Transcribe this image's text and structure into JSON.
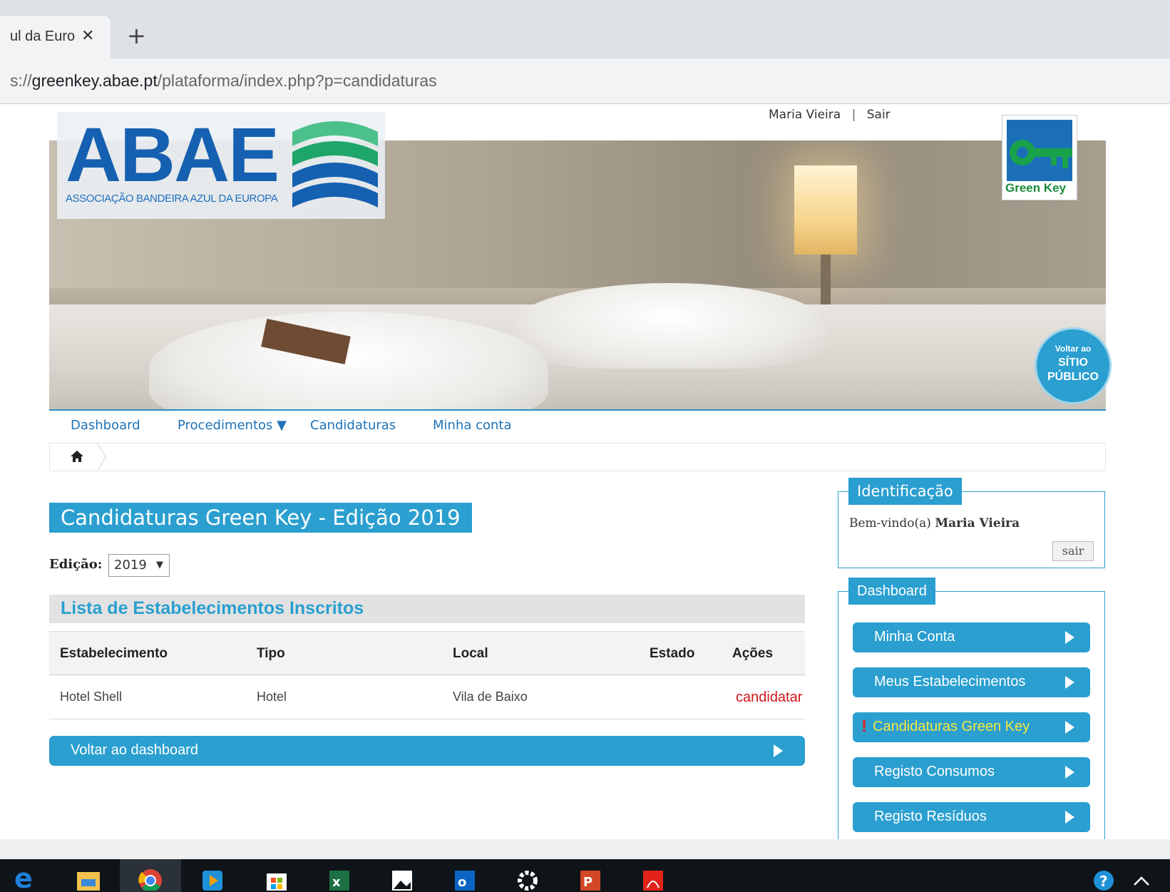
{
  "browser": {
    "tab_title": "ul da Euro",
    "tab_close": "✕",
    "new_tab": "+",
    "url_prefix": "s://",
    "url_host": "greenkey.abae.pt",
    "url_path": "/plataforma/index.php?p=candidaturas"
  },
  "userbar": {
    "name": "Maria Vieira",
    "separator": "|",
    "logout": "Sair"
  },
  "banner": {
    "logo_text": "ABAE",
    "logo_subtitle": "ASSOCIAÇÃO BANDEIRA AZUL DA EUROPA",
    "greenkey_label": "Green Key",
    "voltar_line1": "Voltar ao",
    "voltar_line2": "SÍTIO",
    "voltar_line3": "PÚBLICO"
  },
  "nav": {
    "items": [
      {
        "label": "Dashboard"
      },
      {
        "label": "Procedimentos ▼"
      },
      {
        "label": "Candidaturas"
      },
      {
        "label": "Minha conta"
      }
    ]
  },
  "main": {
    "title": "Candidaturas Green Key - Edição 2019",
    "edicao_label": "Edição:",
    "edicao_value": "2019",
    "edicao_caret": "▼",
    "list_title": "Lista de Estabelecimentos Inscritos",
    "columns": [
      "Estabelecimento",
      "Tipo",
      "Local",
      "Estado",
      "Ações"
    ],
    "rows": [
      {
        "estabelecimento": "Hotel Shell",
        "tipo": "Hotel",
        "local": "Vila de Baixo",
        "estado": "",
        "acao": "candidatar"
      }
    ],
    "back_button": "Voltar ao dashboard"
  },
  "sidebar": {
    "ident_title": "Identificação",
    "welcome_prefix": "Bem-vindo(a)",
    "welcome_name": "Maria Vieira",
    "sair_button": "sair",
    "dashboard_title": "Dashboard",
    "buttons": [
      {
        "label": "Minha Conta"
      },
      {
        "label": "Meus Estabelecimentos"
      },
      {
        "label": "Candidaturas Green Key",
        "alert": "!"
      },
      {
        "label": "Registo Consumos"
      },
      {
        "label": "Registo Resíduos"
      }
    ]
  },
  "colors": {
    "accent": "#2a9fd0",
    "nav_link": "#1e73b8",
    "action_red": "#d0151b",
    "alert_yellow": "#f6e640"
  }
}
